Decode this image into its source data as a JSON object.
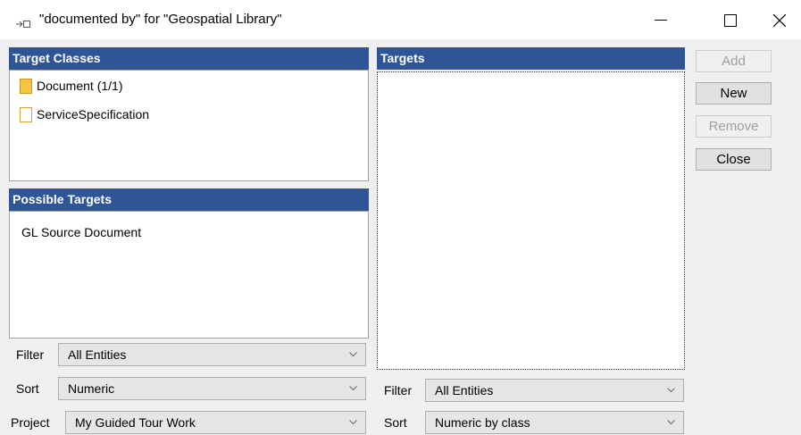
{
  "window": {
    "title": "\"documented by\" for \"Geospatial Library\"",
    "minimize_glyph": "—",
    "maximize_glyph": "☐",
    "close_glyph": "✕"
  },
  "target_classes": {
    "header": "Target Classes",
    "items": [
      {
        "label": "Document  (1/1)",
        "icon": "folder-icon"
      },
      {
        "label": "ServiceSpecification",
        "icon": "document-icon"
      }
    ]
  },
  "possible_targets": {
    "header": "Possible Targets",
    "items": [
      "GL Source Document"
    ]
  },
  "targets": {
    "header": "Targets"
  },
  "left_controls": {
    "filter_label": "Filter",
    "filter_value": "All Entities",
    "sort_label": "Sort",
    "sort_value": "Numeric",
    "project_label": "Project",
    "project_value": "My Guided Tour Work"
  },
  "right_controls": {
    "filter_label": "Filter",
    "filter_value": "All Entities",
    "sort_label": "Sort",
    "sort_value": "Numeric by class"
  },
  "buttons": {
    "add": "Add",
    "new": "New",
    "remove": "Remove",
    "close": "Close"
  },
  "colors": {
    "header_bg": "#2f5597",
    "folder_fill": "#f5c542",
    "doc_outline": "#e0a040"
  }
}
